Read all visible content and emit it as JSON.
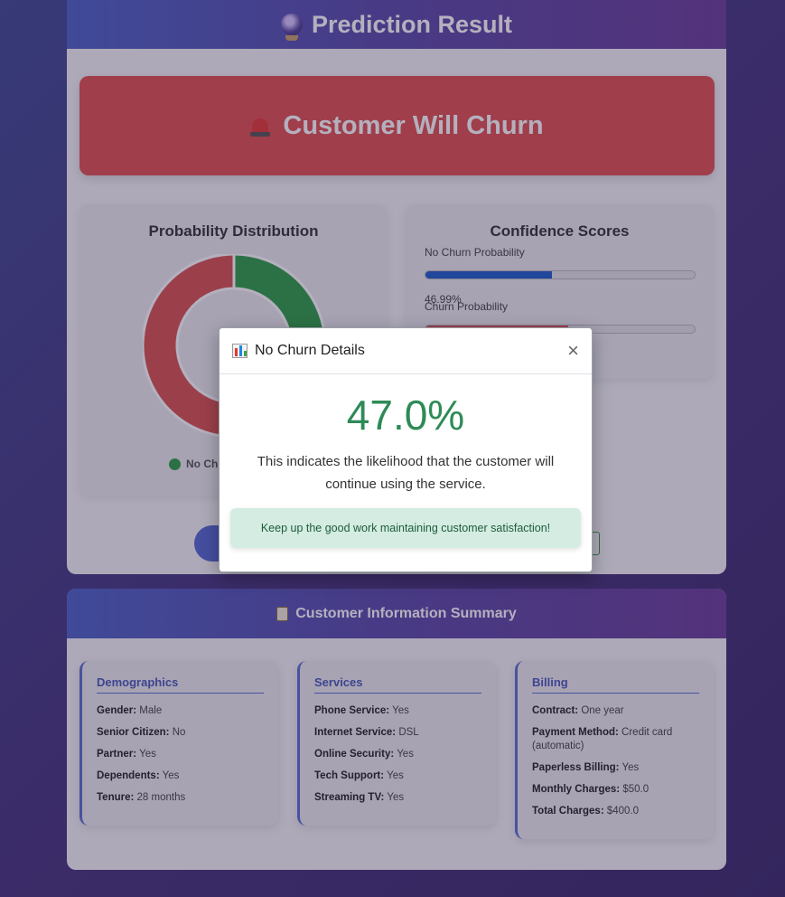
{
  "result": {
    "title": "Prediction Result",
    "verdict": "Customer Will Churn",
    "distribution": {
      "title": "Probability Distribution",
      "legend_no_churn": "No Chu",
      "no_churn_pct": 46.99,
      "churn_pct": 53.01,
      "colors": {
        "no_churn": "#2e9e45",
        "churn": "#d9534f"
      }
    },
    "confidence": {
      "title": "Confidence Scores",
      "no_churn_label": "No Churn Probability",
      "no_churn_value": "46.99%",
      "no_churn_fraction": 0.4699,
      "churn_label": "Churn Probability",
      "churn_fraction": 0.5301
    }
  },
  "summary": {
    "title": "Customer Information Summary",
    "demographics": {
      "title": "Demographics",
      "rows": [
        {
          "label": "Gender:",
          "value": "Male"
        },
        {
          "label": "Senior Citizen:",
          "value": "No"
        },
        {
          "label": "Partner:",
          "value": "Yes"
        },
        {
          "label": "Dependents:",
          "value": "Yes"
        },
        {
          "label": "Tenure:",
          "value": "28 months"
        }
      ]
    },
    "services": {
      "title": "Services",
      "rows": [
        {
          "label": "Phone Service:",
          "value": "Yes"
        },
        {
          "label": "Internet Service:",
          "value": "DSL"
        },
        {
          "label": "Online Security:",
          "value": "Yes"
        },
        {
          "label": "Tech Support:",
          "value": "Yes"
        },
        {
          "label": "Streaming TV:",
          "value": "Yes"
        }
      ]
    },
    "billing": {
      "title": "Billing",
      "rows": [
        {
          "label": "Contract:",
          "value": "One year"
        },
        {
          "label": "Payment Method:",
          "value": "Credit card (automatic)"
        },
        {
          "label": "Paperless Billing:",
          "value": "Yes"
        },
        {
          "label": "Monthly Charges:",
          "value": "$50.0"
        },
        {
          "label": "Total Charges:",
          "value": "$400.0"
        }
      ]
    }
  },
  "modal": {
    "title": "No Churn Details",
    "close_symbol": "×",
    "percentage": "47.0%",
    "description": "This indicates the likelihood that the customer will continue using the service.",
    "message": "Keep up the good work maintaining customer satisfaction!"
  }
}
